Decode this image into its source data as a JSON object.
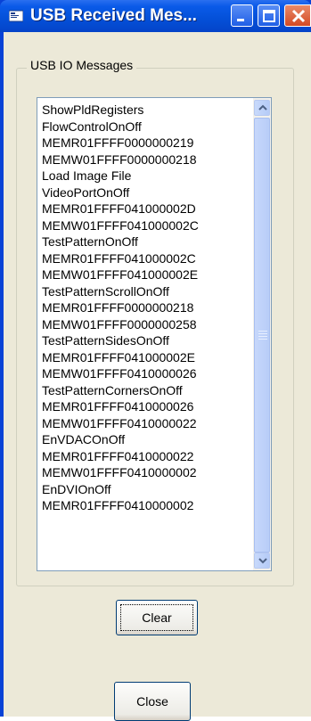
{
  "window": {
    "title": "USB Received Mes...",
    "controls": {
      "minimize": "minimize",
      "maximize": "maximize",
      "close": "close"
    }
  },
  "group": {
    "label": "USB IO Messages"
  },
  "messages": [
    "ShowPldRegisters",
    "FlowControlOnOff",
    "MEMR01FFFF0000000219",
    "MEMW01FFFF0000000218",
    "Load Image File",
    "VideoPortOnOff",
    "MEMR01FFFF041000002D",
    "MEMW01FFFF041000002C",
    "TestPatternOnOff",
    "MEMR01FFFF041000002C",
    "MEMW01FFFF041000002E",
    "TestPatternScrollOnOff",
    "MEMR01FFFF0000000218",
    "MEMW01FFFF0000000258",
    "TestPatternSidesOnOff",
    "MEMR01FFFF041000002E",
    "MEMW01FFFF0410000026",
    "TestPatternCornersOnOff",
    "MEMR01FFFF0410000026",
    "MEMW01FFFF0410000022",
    "EnVDACOnOff",
    "MEMR01FFFF0410000022",
    "MEMW01FFFF0410000002",
    "EnDVIOnOff",
    "MEMR01FFFF0410000002"
  ],
  "buttons": {
    "clear": "Clear",
    "close": "Close"
  },
  "colors": {
    "titlebar": "#0450d8",
    "client": "#ece9d8",
    "close_button": "#d44a23"
  }
}
